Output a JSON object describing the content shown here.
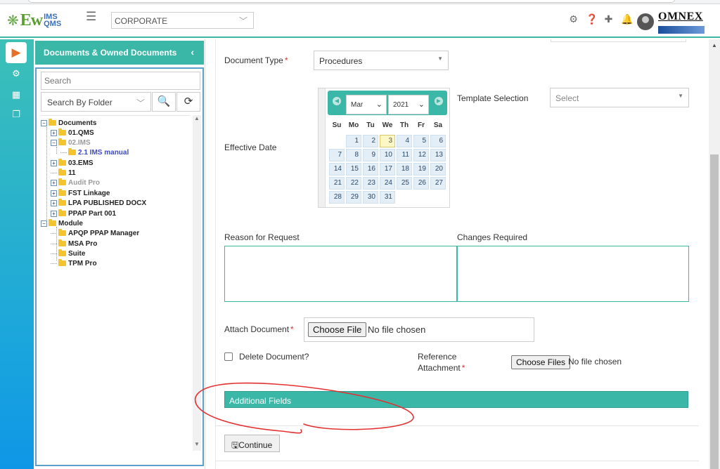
{
  "app": {
    "logo_main": "Ew",
    "logo_sup": "IMS",
    "logo_sub": "QMS",
    "company_select": "CORPORATE",
    "brand": "OMNEX",
    "header_icons": [
      "gear-icon",
      "help-icon",
      "plus-icon",
      "bell-icon"
    ],
    "accent_color": "#3bb7a8"
  },
  "rail": {
    "items": [
      "document-icon",
      "settings-group-icon",
      "building-icon",
      "copy-icon"
    ]
  },
  "panel": {
    "title": "Documents & Owned Documents",
    "search_placeholder": "Search",
    "folder_select": "Search By Folder",
    "tree": [
      {
        "label": "Documents",
        "state": "normal"
      },
      {
        "label": "01.QMS",
        "state": "normal"
      },
      {
        "label": "02.IMS",
        "state": "grey"
      },
      {
        "label": "2.1 IMS manual",
        "state": "link"
      },
      {
        "label": "03.EMS",
        "state": "normal"
      },
      {
        "label": "11",
        "state": "normal"
      },
      {
        "label": "Audit Pro",
        "state": "grey"
      },
      {
        "label": "FST Linkage",
        "state": "normal"
      },
      {
        "label": "LPA PUBLISHED DOCX",
        "state": "normal"
      },
      {
        "label": "PPAP Part 001",
        "state": "normal"
      },
      {
        "label": "Module",
        "state": "normal"
      },
      {
        "label": "APQP PPAP Manager",
        "state": "normal"
      },
      {
        "label": "MSA Pro",
        "state": "normal"
      },
      {
        "label": "Suite",
        "state": "normal"
      },
      {
        "label": "TPM Pro",
        "state": "normal"
      }
    ]
  },
  "form": {
    "document_type_label": "Document Type",
    "document_type_value": "Procedures",
    "template_selection_label": "Template Selection",
    "template_selection_value": "Select",
    "effective_date_label": "Effective Date",
    "calendar": {
      "month": "Mar",
      "year": "2021",
      "weekdays": [
        "Su",
        "Mo",
        "Tu",
        "We",
        "Th",
        "Fr",
        "Sa"
      ],
      "weeks": [
        [
          "",
          "1",
          "2",
          "3",
          "4",
          "5",
          "6"
        ],
        [
          "7",
          "8",
          "9",
          "10",
          "11",
          "12",
          "13"
        ],
        [
          "14",
          "15",
          "16",
          "17",
          "18",
          "19",
          "20"
        ],
        [
          "21",
          "22",
          "23",
          "24",
          "25",
          "26",
          "27"
        ],
        [
          "28",
          "29",
          "30",
          "31",
          "",
          "",
          ""
        ]
      ],
      "highlighted_day": "3"
    },
    "reason_label": "Reason for Request",
    "changes_label": "Changes Required",
    "attach_label": "Attach Document",
    "attach_button": "Choose File",
    "attach_status": "No file chosen",
    "delete_label": "Delete Document?",
    "reference_label_line1": "Reference",
    "reference_label_line2": "Attachment",
    "reference_button": "Choose Files",
    "reference_status": "No file chosen",
    "additional_fields": "Additional Fields",
    "continue_label": "Continue",
    "required_mark": "*"
  }
}
